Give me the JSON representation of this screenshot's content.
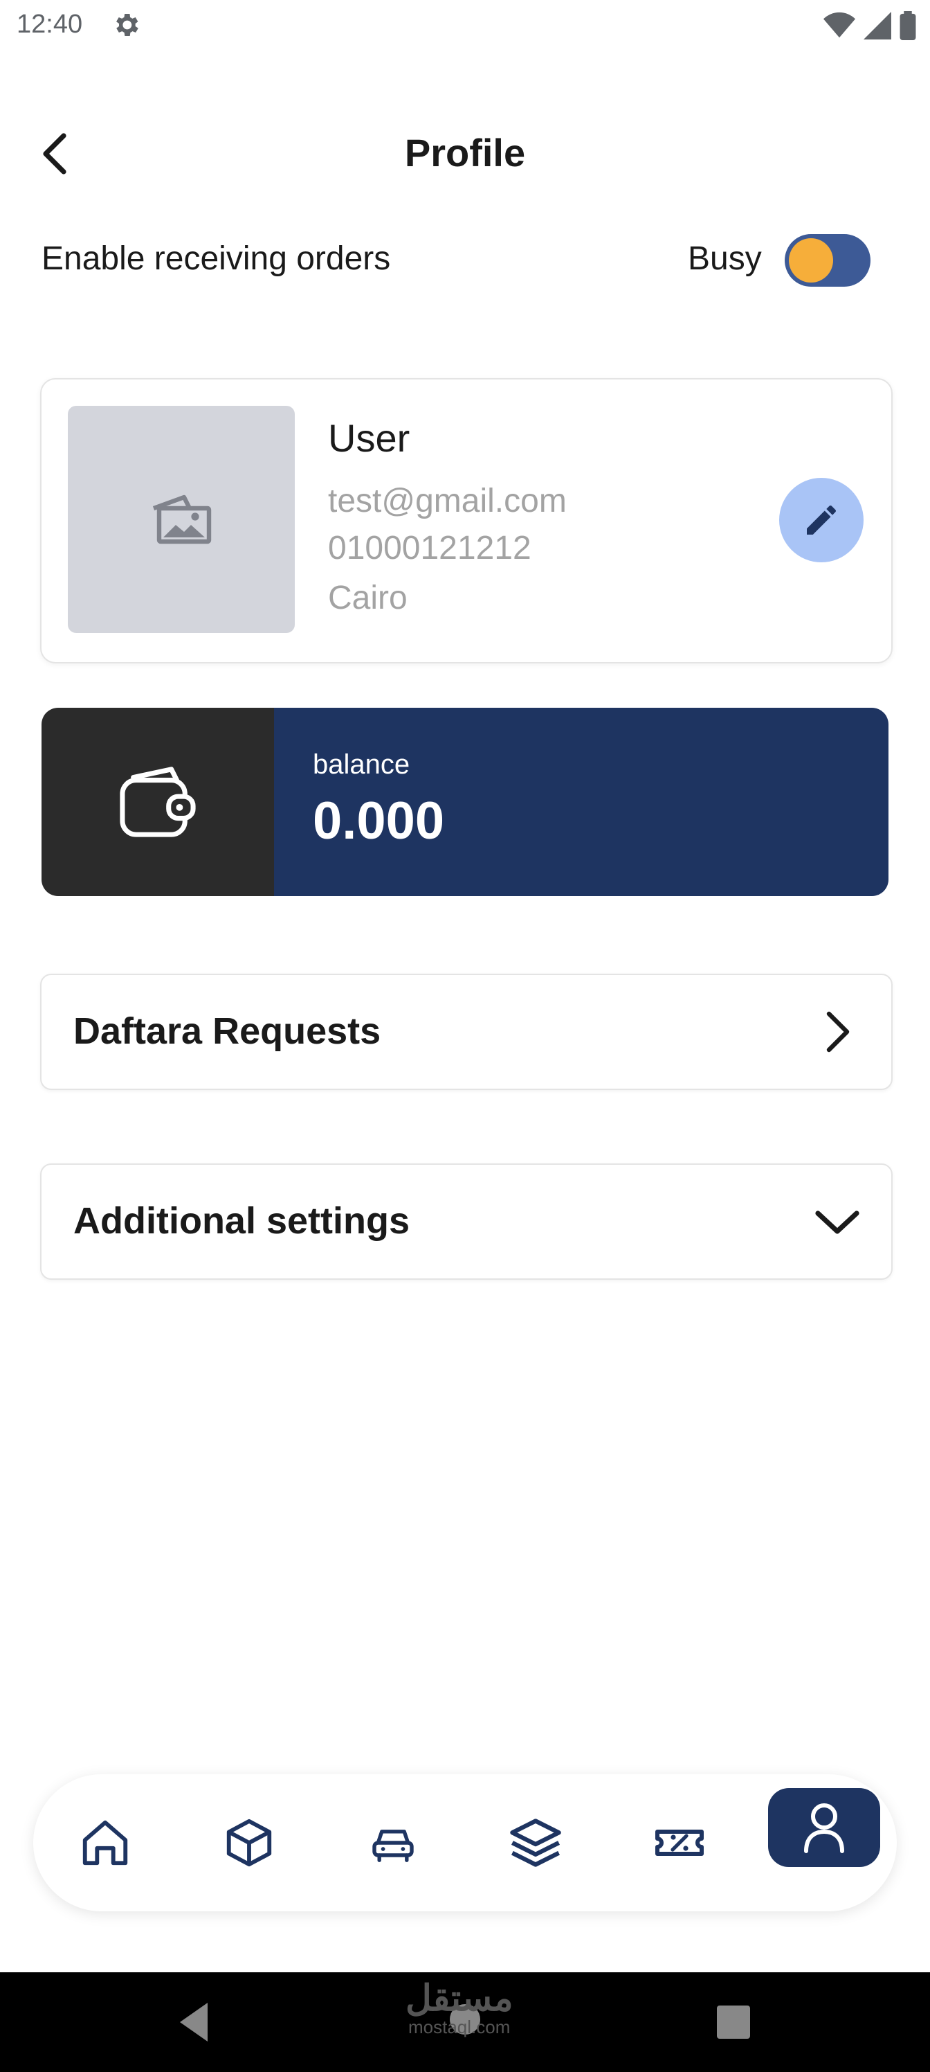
{
  "status_bar": {
    "time": "12:40"
  },
  "header": {
    "title": "Profile"
  },
  "orders_toggle": {
    "label": "Enable receiving orders",
    "state_label": "Busy",
    "enabled": true
  },
  "user": {
    "name": "User",
    "email": "test@gmail.com",
    "phone": "01000121212",
    "city": "Cairo"
  },
  "balance": {
    "label": "balance",
    "value": "0.000"
  },
  "menu": [
    {
      "label": "Daftara Requests",
      "icon": "chevron-right-icon"
    },
    {
      "label": "Additional settings",
      "icon": "chevron-down-icon"
    }
  ],
  "bottom_nav": {
    "items": [
      "home-icon",
      "box-icon",
      "car-icon",
      "layers-icon",
      "discount-ticket-icon",
      "profile-icon"
    ],
    "active": "profile-icon"
  },
  "watermark": {
    "text": "مستقل",
    "sub": "mostaql.com"
  },
  "colors": {
    "primary": "#1e3461",
    "accent": "#f6ae3a",
    "toggle_track": "#3d5a96",
    "edit_button": "#a9c4f6",
    "wallet_bg": "#2b2b2b"
  }
}
